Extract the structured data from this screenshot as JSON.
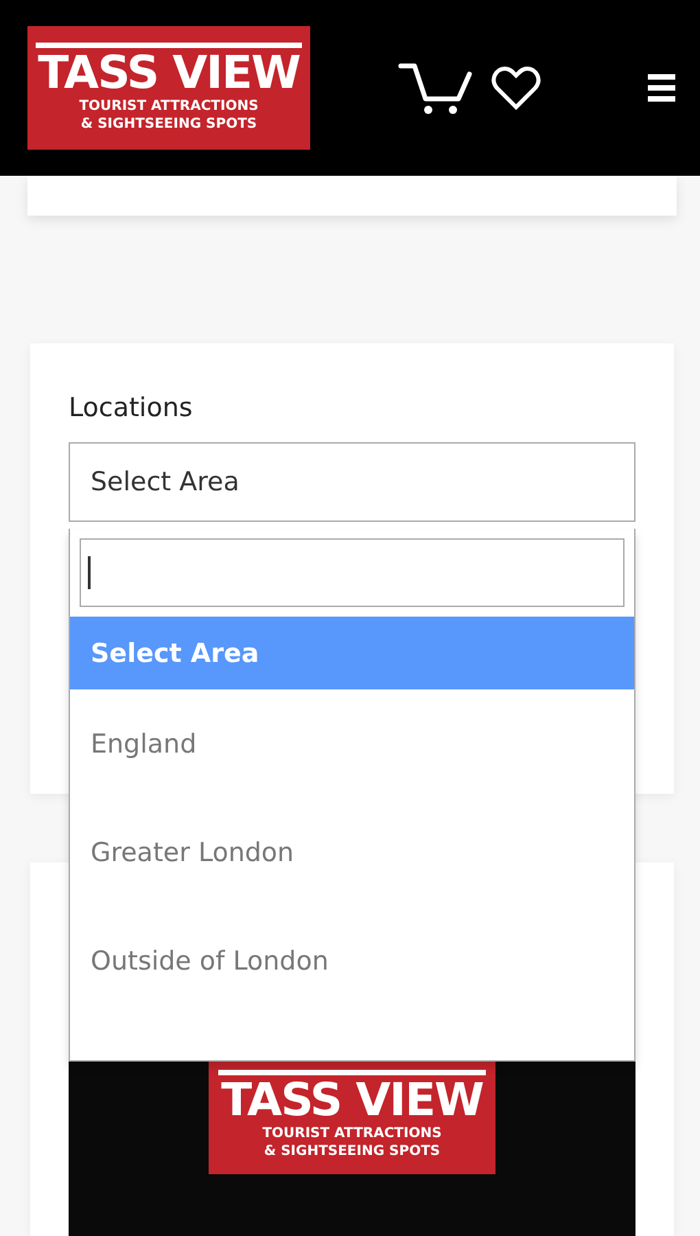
{
  "header": {
    "logo": {
      "title": "TASS VIEW",
      "tagline_1": "TOURIST ATTRACTIONS",
      "tagline_2": "& SIGHTSEEING SPOTS"
    }
  },
  "locations": {
    "label": "Locations",
    "value": "Select Area",
    "open": true,
    "options": [
      {
        "label": "Select Area",
        "selected": true
      },
      {
        "label": "England",
        "selected": false
      },
      {
        "label": "Greater London",
        "selected": false
      },
      {
        "label": "Outside of London",
        "selected": false
      }
    ]
  },
  "promo": {
    "logo": {
      "title": "TASS VIEW",
      "tagline_1": "TOURIST ATTRACTIONS",
      "tagline_2": "& SIGHTSEEING SPOTS"
    }
  }
}
